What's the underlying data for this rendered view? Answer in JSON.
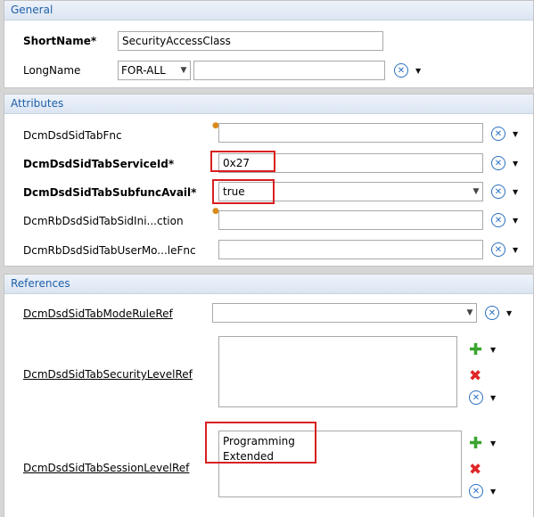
{
  "general": {
    "header": "General",
    "shortname_label": "ShortName*",
    "shortname_value": "SecurityAccessClass",
    "longname_label": "LongName",
    "longname_lang": "FOR-ALL",
    "longname_value": ""
  },
  "attributes": {
    "header": "Attributes",
    "items": [
      {
        "label": "DcmDsdSidTabFnc",
        "value": ""
      },
      {
        "label": "DcmDsdSidTabServiceId*",
        "value": "0x27"
      },
      {
        "label": "DcmDsdSidTabSubfuncAvail*",
        "value": "true"
      },
      {
        "label": "DcmRbDsdSidTabSidIni...ction",
        "value": ""
      },
      {
        "label": "DcmRbDsdSidTabUserMo...leFnc",
        "value": ""
      }
    ]
  },
  "references": {
    "header": "References",
    "mode_rule_label": "DcmDsdSidTabModeRuleRef",
    "mode_rule_value": "",
    "security_label": "DcmDsdSidTabSecurityLevelRef",
    "security_items": [],
    "session_label": "DcmDsdSidTabSessionLevelRef",
    "session_items": [
      "Programming",
      "Extended"
    ]
  },
  "icons": {
    "reset": "reset-x-circle-icon",
    "add": "green-plus-icon",
    "remove": "red-x-icon",
    "dropdown": "triangle-down-icon"
  },
  "colors": {
    "section_header_text": "#1f5fa8",
    "highlight": "#d81f1f",
    "add_icon": "#3aa52f",
    "remove_icon": "#e02727",
    "reset_icon": "#2a6fbf"
  }
}
